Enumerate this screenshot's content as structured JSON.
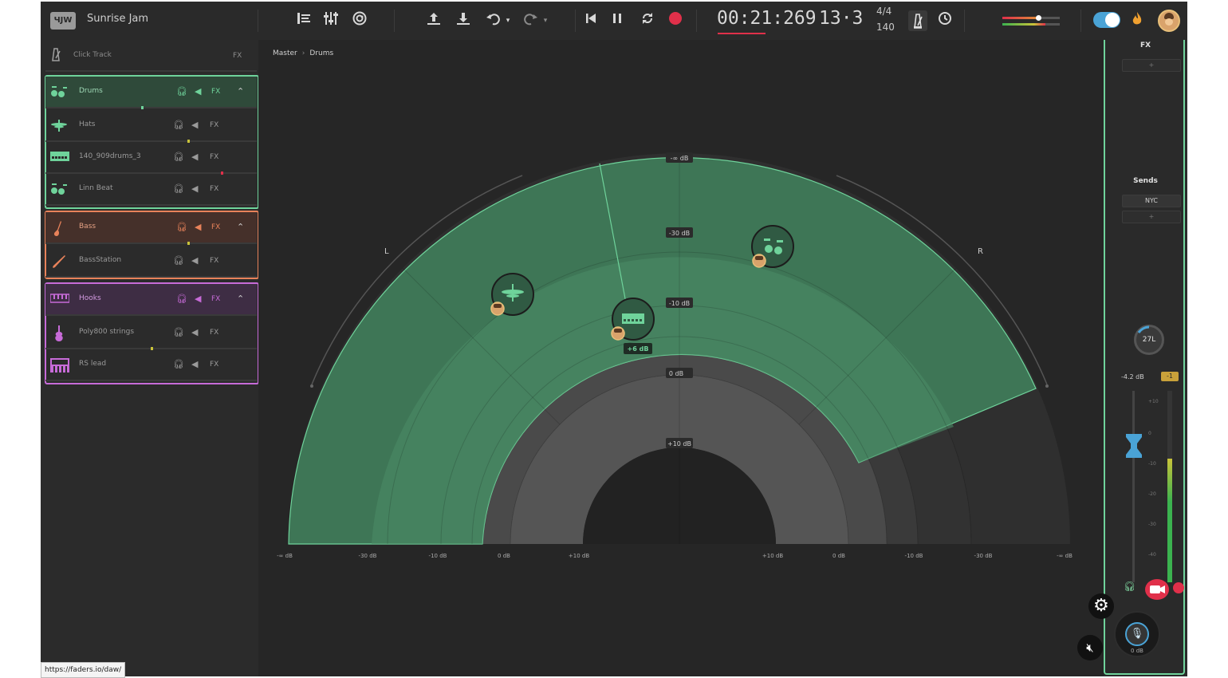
{
  "project": {
    "title": "Sunrise Jam",
    "logo_text": "ЧJW"
  },
  "transport": {
    "time": "00:21:269",
    "bar_beat": "13·3",
    "time_signature": "4/4",
    "tempo": "140"
  },
  "sidebar": {
    "click_track": {
      "name": "Click Track",
      "fx": "FX"
    },
    "tracks": [
      {
        "name": "Drums",
        "type": "group",
        "color": "#6fd39b"
      },
      {
        "name": "Hats",
        "type": "child",
        "color": "#6fd39b"
      },
      {
        "name": "140_909drums_3",
        "type": "child",
        "color": "#6fd39b"
      },
      {
        "name": "Linn Beat",
        "type": "child",
        "color": "#6fd39b"
      },
      {
        "name": "Bass",
        "type": "group",
        "color": "#e8825a"
      },
      {
        "name": "BassStation",
        "type": "child",
        "color": "#e8825a"
      },
      {
        "name": "Hooks",
        "type": "group",
        "color": "#c76bd8"
      },
      {
        "name": "Poly800 strings",
        "type": "child",
        "color": "#c76bd8"
      },
      {
        "name": "RS lead",
        "type": "child",
        "color": "#c76bd8"
      }
    ],
    "fx_label": "FX"
  },
  "breadcrumb": {
    "root": "Master",
    "current": "Drums"
  },
  "panner": {
    "left_label": "L",
    "right_label": "R",
    "ring_labels": [
      "-∞ dB",
      "-30 dB",
      "-10 dB",
      "0 dB",
      "+10 dB"
    ],
    "axis_labels": [
      "-∞ dB",
      "-30 dB",
      "-10 dB",
      "0 dB",
      "+10 dB",
      "+10 dB",
      "0 dB",
      "-10 dB",
      "-30 dB",
      "-∞ dB"
    ],
    "selected_gain": "+6 dB",
    "colors": {
      "zone": "#3f7a59",
      "zone_light": "#4b8a66",
      "accent": "#6fd39b"
    }
  },
  "right_panel": {
    "fx_title": "FX",
    "slot_add": "+",
    "sends_title": "Sends",
    "send_name": "NYC",
    "pan_value": "27L",
    "gain": "-4.2 dB",
    "mute_badge": "-1",
    "scale": [
      "+10",
      "0",
      "-10",
      "-20",
      "-30",
      "-40"
    ],
    "mic_db": "0 dB"
  },
  "status_url": "https://faders.io/daw/"
}
